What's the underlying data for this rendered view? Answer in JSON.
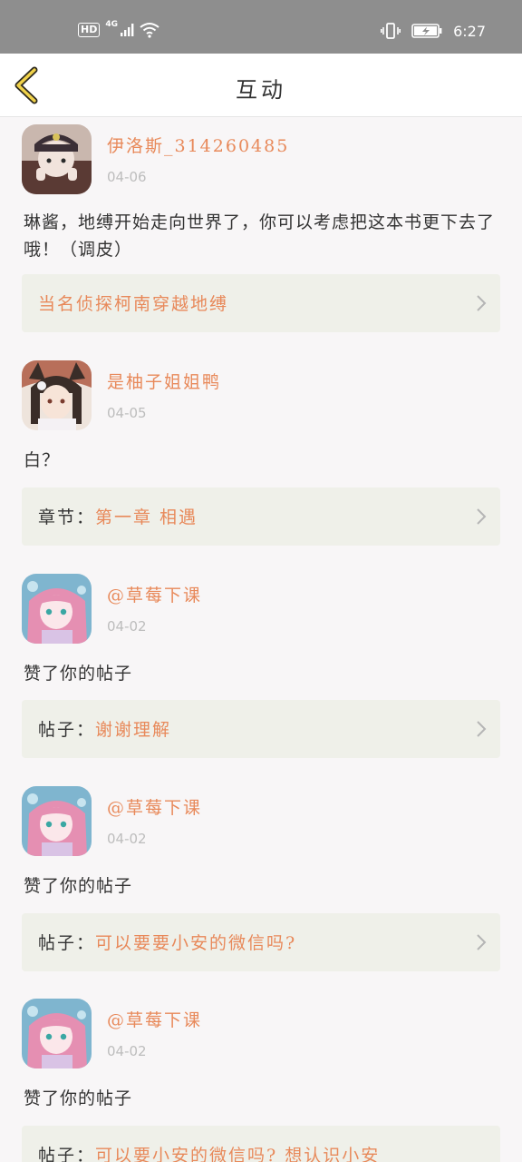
{
  "status_bar": {
    "hd": "HD",
    "network": "4G",
    "time": "6:27"
  },
  "header": {
    "title": "互动"
  },
  "items": [
    {
      "username": "伊洛斯_314260485",
      "date": "04-06",
      "content": "琳酱，地缚开始走向世界了，你可以考虑把这本书更下去了哦！（调皮）",
      "ref_prefix": "",
      "ref_title": "当名侦探柯南穿越地缚"
    },
    {
      "username": "是柚子姐姐鸭",
      "date": "04-05",
      "content": "白？",
      "ref_prefix": "章节：",
      "ref_title": "第一章 相遇"
    },
    {
      "username": "@草莓下课",
      "date": "04-02",
      "content": "赞了你的帖子",
      "ref_prefix": "帖子：",
      "ref_title": "谢谢理解"
    },
    {
      "username": "@草莓下课",
      "date": "04-02",
      "content": "赞了你的帖子",
      "ref_prefix": "帖子：",
      "ref_title": "可以要要小安的微信吗?"
    },
    {
      "username": "@草莓下课",
      "date": "04-02",
      "content": "赞了你的帖子",
      "ref_prefix": "帖子：",
      "ref_title": "可以要小安的微信吗? 想认识小安"
    }
  ]
}
